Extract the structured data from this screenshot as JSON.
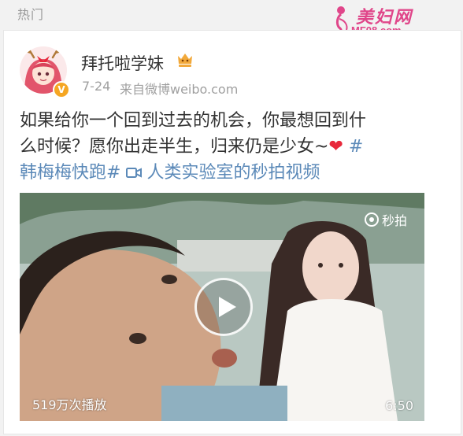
{
  "header": {
    "section_title": "热门"
  },
  "watermark": {
    "site_name": "美妇网",
    "url": "MF08.com"
  },
  "post": {
    "username": "拜托啦学妹",
    "user_badge_icon": "crown-face-icon",
    "verified_icon": "v-badge-icon",
    "time": "7-24",
    "source": "来自微博weibo.com",
    "text_line1": "如果给你一个回到过去的机会，你最想回到什",
    "text_line2": "么时候？愿你出走半生，归来仍是少女~",
    "heart": "❤",
    "hashtag1": "#",
    "hashtag2": "韩梅梅快跑#",
    "video_link": "人类实验室的秒拍视频",
    "link_color": "#5b89b8"
  },
  "video": {
    "brand": "秒拍",
    "play_count": "519万次播放",
    "duration": "6:50"
  }
}
